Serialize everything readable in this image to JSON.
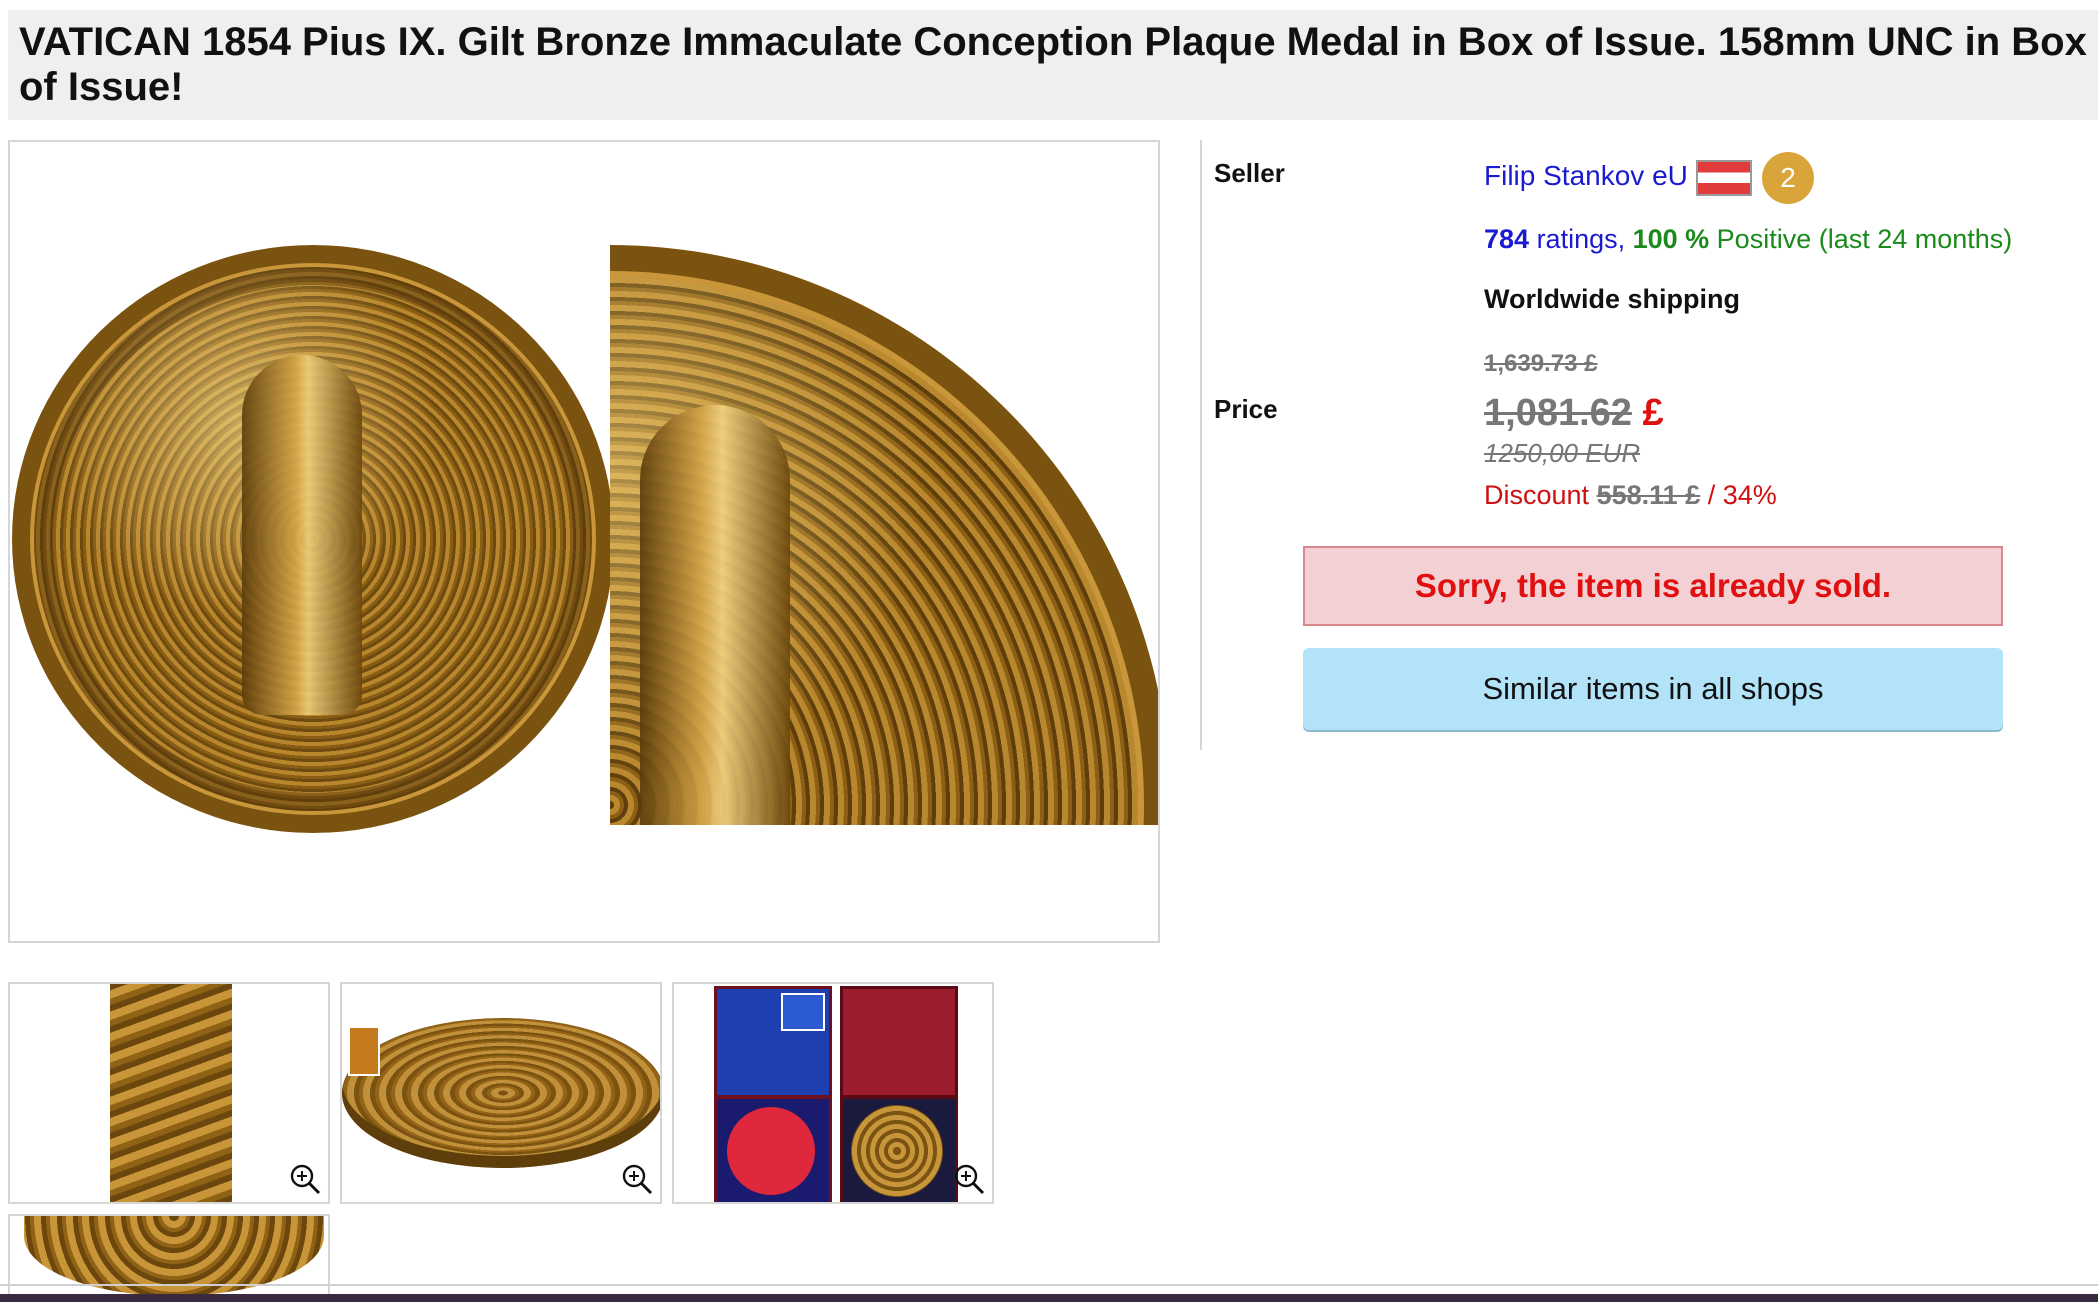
{
  "title": "VATICAN 1854 Pius IX. Gilt Bronze Immaculate Conception Plaque Medal in Box of Issue. 158mm UNC in Box of Issue!",
  "seller": {
    "label": "Seller",
    "name": "Filip Stankov eU",
    "flag_icon": "austria-flag-icon",
    "badge_value": "2",
    "ratings_count": "784",
    "ratings_word": " ratings, ",
    "positive_percent": "100 %",
    "positive_text": " Positive (last 24 months)",
    "shipping": "Worldwide shipping"
  },
  "price": {
    "label": "Price",
    "old_price": "1,639.73 £",
    "current_amount": "1,081.62",
    "currency": "£",
    "eur_price": "1250,00 EUR",
    "discount_label": "Discount",
    "discount_amount": "558.11 £",
    "discount_percent": " / 34%"
  },
  "status": {
    "sold_message": "Sorry, the item is already sold.",
    "similar_button": "Similar items in all shops"
  },
  "colors": {
    "link_blue": "#1a1ad1",
    "positive_green": "#1a8a1a",
    "price_red": "#e01010",
    "sold_bg": "#f2d0d3",
    "similar_bg": "#b3e3f8",
    "badge_gold": "#d9a53a"
  },
  "thumbnails": {
    "zoom_icon": "magnifier-zoom-icon",
    "count": 4
  }
}
